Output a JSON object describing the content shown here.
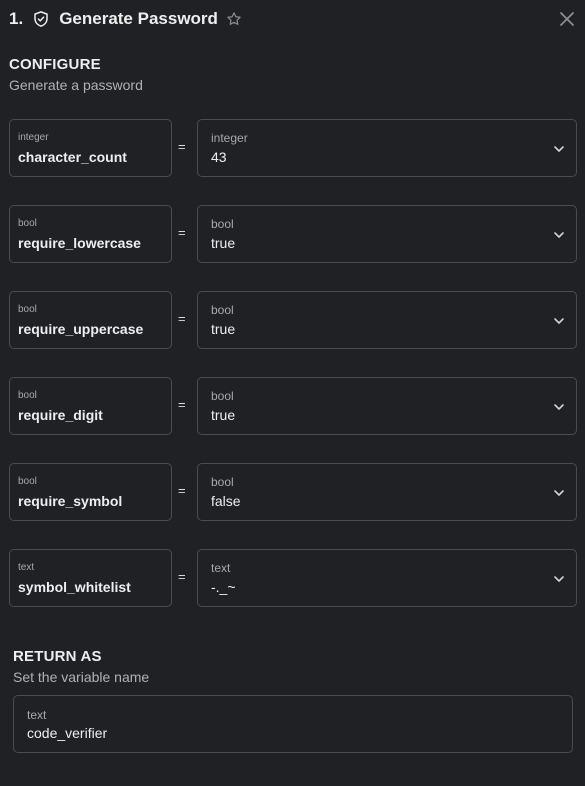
{
  "header": {
    "step": "1.",
    "title": "Generate Password",
    "icon": "shield-check-icon"
  },
  "configure": {
    "title": "CONFIGURE",
    "subtitle": "Generate a password"
  },
  "params": [
    {
      "type": "integer",
      "name": "character_count",
      "value_type": "integer",
      "value": "43"
    },
    {
      "type": "bool",
      "name": "require_lowercase",
      "value_type": "bool",
      "value": "true"
    },
    {
      "type": "bool",
      "name": "require_uppercase",
      "value_type": "bool",
      "value": "true"
    },
    {
      "type": "bool",
      "name": "require_digit",
      "value_type": "bool",
      "value": "true"
    },
    {
      "type": "bool",
      "name": "require_symbol",
      "value_type": "bool",
      "value": "false"
    },
    {
      "type": "text",
      "name": "symbol_whitelist",
      "value_type": "text",
      "value": "-._~"
    }
  ],
  "equals_sign": "=",
  "return_as": {
    "title": "RETURN AS",
    "subtitle": "Set the variable name",
    "type": "text",
    "value": "code_verifier"
  }
}
